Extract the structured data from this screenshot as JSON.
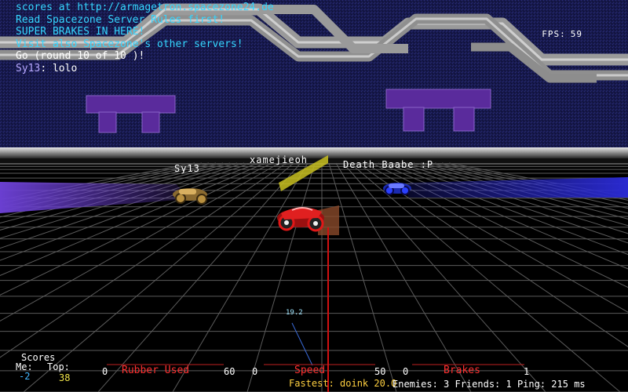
{
  "chat": {
    "lines": [
      "scores at http://armagetron.spacezone24.de",
      "Read Spacezone Server Rules first!",
      "SUPER BRAKES IN HERE!",
      "Visit also Spacezone's other servers!",
      "Go (round 10 of 10 )!"
    ],
    "last_speaker": "Sy13",
    "last_message": "lolo"
  },
  "fps": {
    "label": "FPS:",
    "value": "59"
  },
  "players": {
    "left": "Sy13",
    "center": "xamejieoh",
    "right": "Death Baabe :P"
  },
  "speedometer": {
    "value": "19.2"
  },
  "hud": {
    "scores_title": "Scores",
    "me_label": "Me:",
    "top_label": "Top:",
    "me_value": "-2",
    "top_value": "38",
    "rubber": {
      "min": "0",
      "label": "Rubber Used",
      "max": "60"
    },
    "speed": {
      "min": "0",
      "label": "Speed",
      "max": "50"
    },
    "brakes": {
      "min": "0",
      "label": "Brakes",
      "max": "1"
    },
    "fastest": "Fastest: doink 20.0",
    "status": "Enemies: 3 Friends: 1 Ping: 215 ms"
  },
  "colors": {
    "wall": "#16184e",
    "floor": "#000000",
    "grid": "#7a7a7a",
    "chat": "#35d6ff",
    "gauge_label": "#ff3030",
    "left_trail": "#6a3fd0",
    "right_trail": "#2a2ad0",
    "center_trail": "#c8c020"
  },
  "icons": [
    "red-lightcycle",
    "gold-lightcycle",
    "blue-lightcycle"
  ]
}
